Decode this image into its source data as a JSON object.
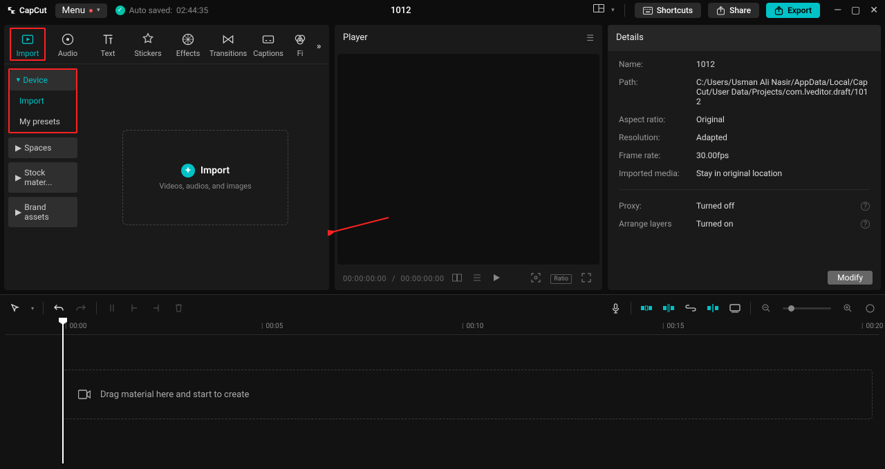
{
  "app": {
    "name": "CapCut",
    "menu_label": "Menu",
    "autosaved_prefix": "Auto saved:",
    "autosaved_time": "02:44:35",
    "project_title": "1012"
  },
  "topbar": {
    "shortcuts": "Shortcuts",
    "share": "Share",
    "export": "Export"
  },
  "tabs": {
    "import": "Import",
    "audio": "Audio",
    "text": "Text",
    "stickers": "Stickers",
    "effects": "Effects",
    "transitions": "Transitions",
    "captions": "Captions",
    "filters": "Fi"
  },
  "sidebar": {
    "device": "Device",
    "import": "Import",
    "my_presets": "My presets",
    "spaces": "Spaces",
    "stock": "Stock mater...",
    "brand": "Brand assets"
  },
  "dropzone": {
    "title": "Import",
    "subtitle": "Videos, audios, and images"
  },
  "player": {
    "title": "Player",
    "timecode_current": "00:00:00:00",
    "timecode_sep": "/",
    "timecode_total": "00:00:00:00",
    "ratio": "Ratio"
  },
  "details": {
    "title": "Details",
    "name_label": "Name:",
    "name_value": "1012",
    "path_label": "Path:",
    "path_value": "C:/Users/Usman Ali Nasir/AppData/Local/CapCut/User Data/Projects/com.lveditor.draft/1012",
    "ar_label": "Aspect ratio:",
    "ar_value": "Original",
    "res_label": "Resolution:",
    "res_value": "Adapted",
    "fps_label": "Frame rate:",
    "fps_value": "30.00fps",
    "media_label": "Imported media:",
    "media_value": "Stay in original location",
    "proxy_label": "Proxy:",
    "proxy_value": "Turned off",
    "layers_label": "Arrange layers",
    "layers_value": "Turned on",
    "modify": "Modify"
  },
  "ruler": {
    "t0": "00:00",
    "t1": "00:05",
    "t2": "00:10",
    "t3": "00:15",
    "t4": "00:20"
  },
  "timeline": {
    "drop_hint": "Drag material here and start to create"
  }
}
